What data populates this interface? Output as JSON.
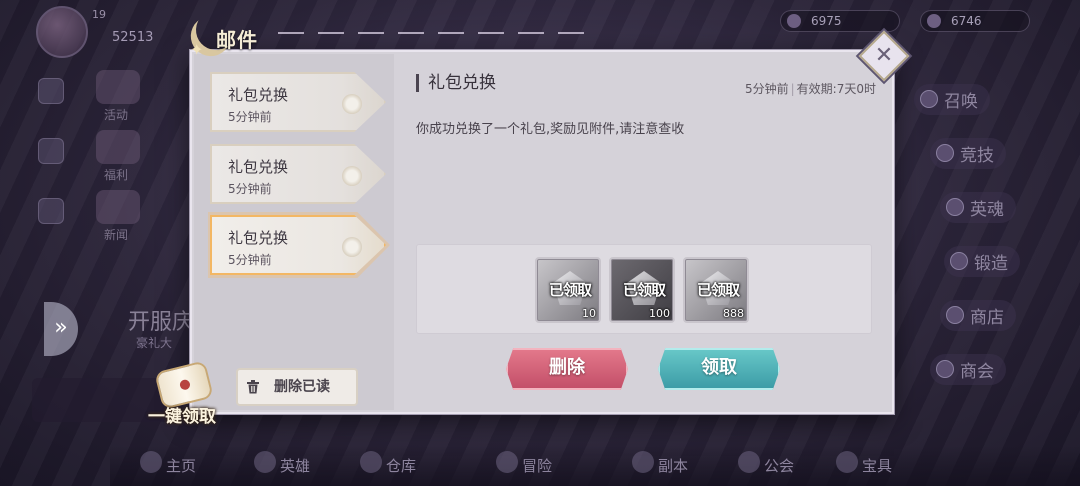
{
  "background": {
    "player": {
      "level": "19",
      "gold": "52513"
    },
    "resources": [
      "6975",
      "6746"
    ],
    "left_menu": [
      "活动",
      "福利",
      "新闻"
    ],
    "server_banner": {
      "title": "开服庆",
      "subtitle": "豪礼大"
    },
    "right_menu": [
      "召唤",
      "竞技",
      "英魂",
      "锻造",
      "商店",
      "商会"
    ],
    "bottom_nav": [
      "主页",
      "英雄",
      "仓库",
      "冒险",
      "副本",
      "公会",
      "宝具"
    ]
  },
  "dialog": {
    "title": "邮件",
    "close_icon": "close-icon",
    "mail_list": [
      {
        "title": "礼包兑换",
        "time": "5分钟前",
        "active": false
      },
      {
        "title": "礼包兑换",
        "time": "5分钟前",
        "active": false
      },
      {
        "title": "礼包兑换",
        "time": "5分钟前",
        "active": true
      }
    ],
    "delete_read_label": "删除已读",
    "detail": {
      "title": "礼包兑换",
      "sent": "5分钟前",
      "expiry": "有效期:7天0时",
      "body": "你成功兑换了一个礼包,奖励见附件,请注意查收",
      "attachments": [
        {
          "status": "已领取",
          "count": "10",
          "icon": "silver-gem-icon"
        },
        {
          "status": "已领取",
          "count": "100",
          "icon": "dark-token-icon"
        },
        {
          "status": "已领取",
          "count": "888",
          "icon": "diamond-icon"
        }
      ],
      "delete_label": "删除",
      "claim_label": "领取"
    }
  },
  "claim_all_label": "一键领取",
  "colors": {
    "accent_active": "#f3b764",
    "delete_button": "#c24d67",
    "claim_button": "#3a9aa5"
  }
}
